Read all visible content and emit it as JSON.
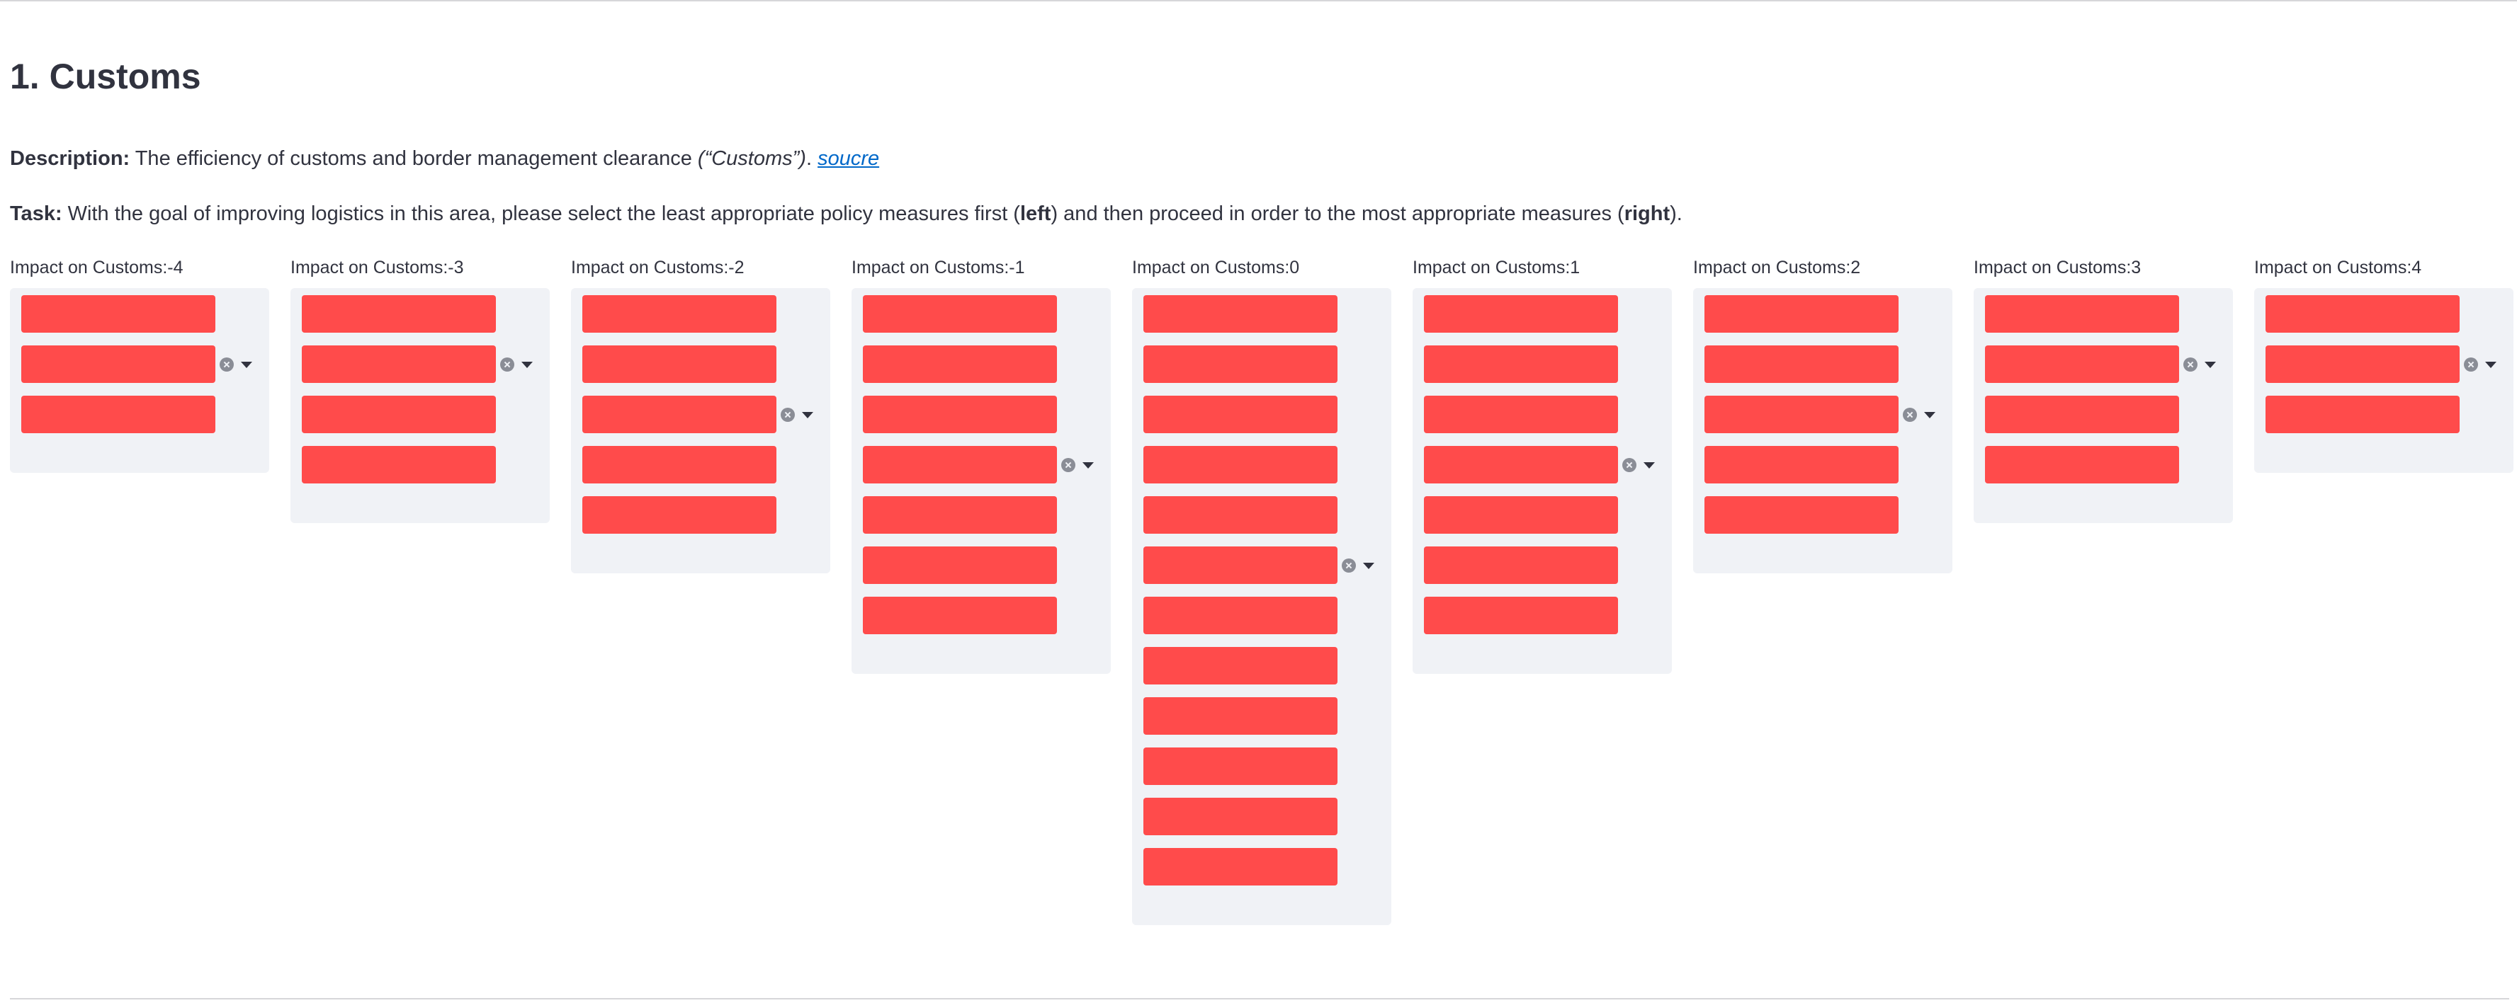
{
  "page": {
    "title": "1. Customs",
    "description": {
      "label": "Description:",
      "text": " The efficiency of customs and border management clearance ",
      "quote": "(“Customs”)",
      "period": ". ",
      "link": "soucre"
    },
    "task": {
      "label": "Task:",
      "text1": " With the goal of improving logistics in this area, please select the least appropriate policy measures first (",
      "left": "left",
      "text2": ") and then proceed in order to the most appropriate measures (",
      "right": "right",
      "text3": ")."
    }
  },
  "columns": [
    {
      "label": "Impact on Customs:-4",
      "item_count": 3
    },
    {
      "label": "Impact on Customs:-3",
      "item_count": 4
    },
    {
      "label": "Impact on Customs:-2",
      "item_count": 5
    },
    {
      "label": "Impact on Customs:-1",
      "item_count": 7
    },
    {
      "label": "Impact on Customs:0",
      "item_count": 12
    },
    {
      "label": "Impact on Customs:1",
      "item_count": 7
    },
    {
      "label": "Impact on Customs:2",
      "item_count": 5
    },
    {
      "label": "Impact on Customs:3",
      "item_count": 4
    },
    {
      "label": "Impact on Customs:4",
      "item_count": 3
    }
  ],
  "icons": {
    "clear": "clear-icon",
    "dropdown": "caret-down-icon"
  },
  "colors": {
    "item": "#ff4b4b",
    "column_background": "#f0f2f6",
    "link": "#0068c9",
    "text": "#31333f"
  }
}
